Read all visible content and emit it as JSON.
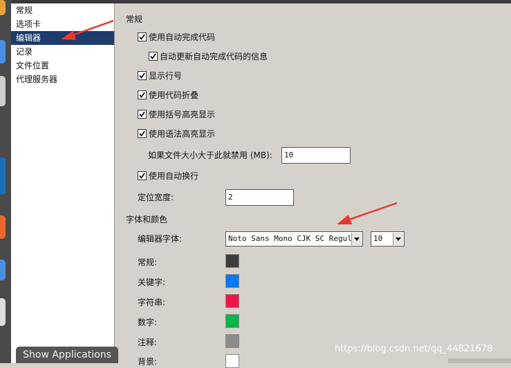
{
  "dock_colors": [
    "#e8a23b",
    "#4a90e2",
    "#cccccc",
    "#1b6fb8",
    "#e66a2c",
    "#4a90e2",
    "#dddddd"
  ],
  "taskbar": {
    "show_applications": "Show Applications"
  },
  "sidebar": {
    "items": [
      {
        "label": "常规",
        "selected": false
      },
      {
        "label": "选项卡",
        "selected": false
      },
      {
        "label": "编辑器",
        "selected": true
      },
      {
        "label": "记录",
        "selected": false
      },
      {
        "label": "文件位置",
        "selected": false
      },
      {
        "label": "代理服务器",
        "selected": false
      }
    ]
  },
  "editor": {
    "general_title": "常规",
    "checkboxes": [
      {
        "label": "使用自动完成代码",
        "checked": true
      },
      {
        "label": "自动更新自动完成代码的信息",
        "checked": true
      },
      {
        "label": "显示行号",
        "checked": true
      },
      {
        "label": "使用代码折叠",
        "checked": true
      },
      {
        "label": "使用括号高亮显示",
        "checked": true
      },
      {
        "label": "使用语法高亮显示",
        "checked": true
      },
      {
        "label": "使用自动换行",
        "checked": true
      }
    ],
    "disable_label": "如果文件大小大于此就禁用 (MB):",
    "disable_value": "10",
    "tab_width_label": "定位宽度:",
    "tab_width_value": "2",
    "fonts_title": "字体和颜色",
    "font_label": "编辑器字体:",
    "font_value": "Noto Sans Mono CJK SC Regular",
    "font_size_value": "10",
    "colors": [
      {
        "label": "常规:",
        "color": "#3c3c3c"
      },
      {
        "label": "关键字:",
        "color": "#0a78f0"
      },
      {
        "label": "字符串:",
        "color": "#f0144a"
      },
      {
        "label": "数字:",
        "color": "#0ab446"
      },
      {
        "label": "注释:",
        "color": "#8c8c8c"
      },
      {
        "label": "背景:",
        "color": "#ffffff"
      }
    ]
  },
  "watermark": "https://blog.csdn.net/qq_44821678"
}
